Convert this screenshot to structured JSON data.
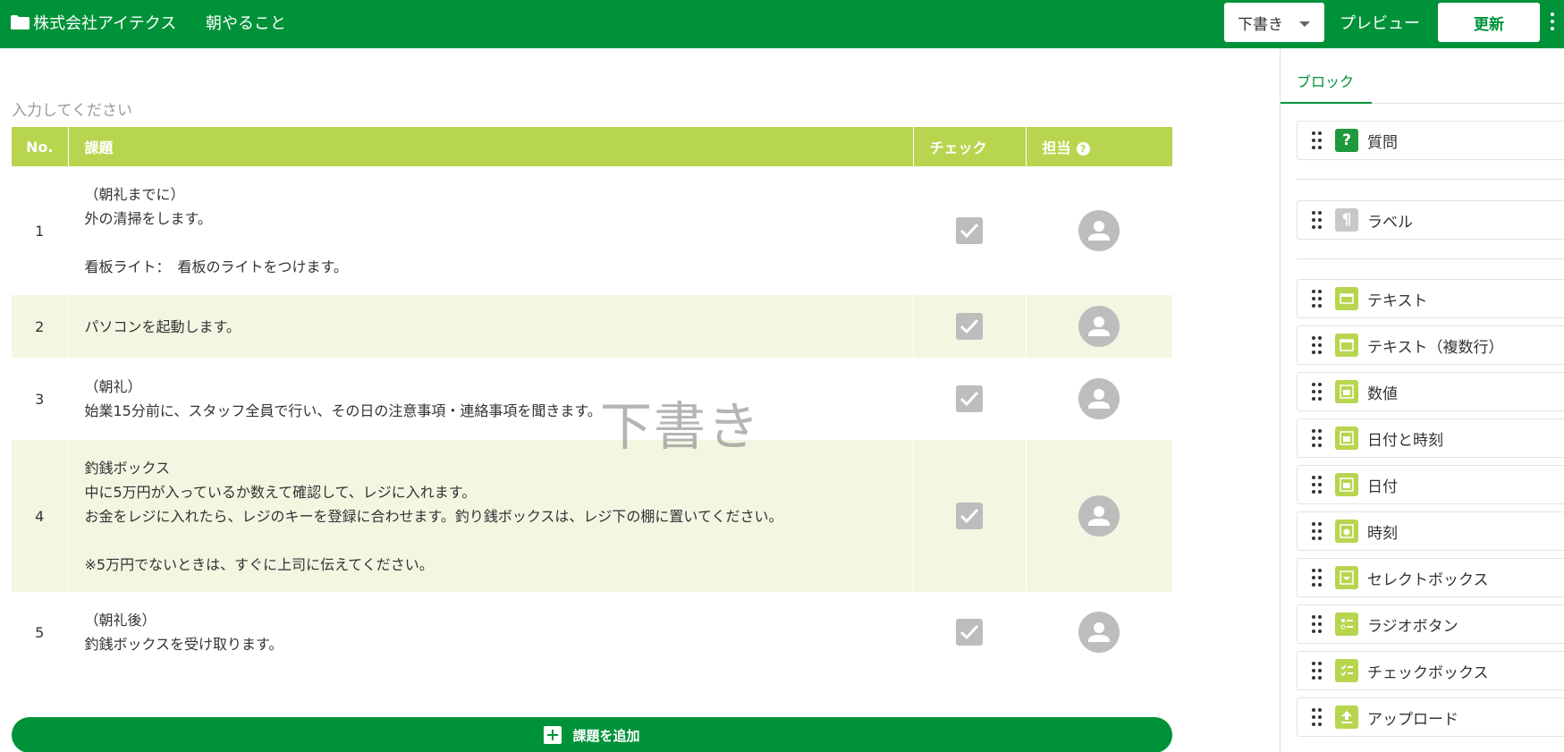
{
  "header": {
    "company": "株式会社アイテクス",
    "doc_title": "朝やること",
    "status_selected": "下書き",
    "preview_label": "プレビュー",
    "update_label": "更新",
    "bg_color": "#009239"
  },
  "main": {
    "description_placeholder": "入力してください",
    "watermark": "下書き",
    "table": {
      "headers": [
        "No.",
        "課題",
        "チェック",
        "担当"
      ],
      "rows": [
        {
          "no": "1",
          "task": "（朝礼までに）\n外の清掃をします。\n\n看板ライト：　看板のライトをつけます。"
        },
        {
          "no": "2",
          "task": "パソコンを起動します。\n"
        },
        {
          "no": "3",
          "task": "（朝礼）\n始業15分前に、スタッフ全員で行い、その日の注意事項・連絡事項を聞きます。"
        },
        {
          "no": "4",
          "task": "釣銭ボックス\n中に5万円が入っているか数えて確認して、レジに入れます。\nお金をレジに入れたら、レジのキーを登録に合わせます。釣り銭ボックスは、レジ下の棚に置いてください。\n\n※5万円でないときは、すぐに上司に伝えてください。"
        },
        {
          "no": "5",
          "task": "（朝礼後）\n釣銭ボックスを受け取ります。"
        }
      ]
    },
    "add_task_label": "課題を追加",
    "header_color": "#b8d54f",
    "alt_row_color": "#f2f7e2"
  },
  "sidebar": {
    "tab_label": "ブロック",
    "items": [
      {
        "label": "質問",
        "icon": "question-icon"
      },
      {
        "label": "ラベル",
        "icon": "paragraph-icon"
      },
      {
        "label": "テキスト",
        "icon": "text-field-icon"
      },
      {
        "label": "テキスト（複数行）",
        "icon": "textarea-icon"
      },
      {
        "label": "数値",
        "icon": "number-icon"
      },
      {
        "label": "日付と時刻",
        "icon": "datetime-icon"
      },
      {
        "label": "日付",
        "icon": "date-icon"
      },
      {
        "label": "時刻",
        "icon": "time-icon"
      },
      {
        "label": "セレクトボックス",
        "icon": "select-icon"
      },
      {
        "label": "ラジオボタン",
        "icon": "radio-icon"
      },
      {
        "label": "チェックボックス",
        "icon": "checkbox-icon"
      },
      {
        "label": "アップロード",
        "icon": "upload-icon"
      }
    ]
  }
}
